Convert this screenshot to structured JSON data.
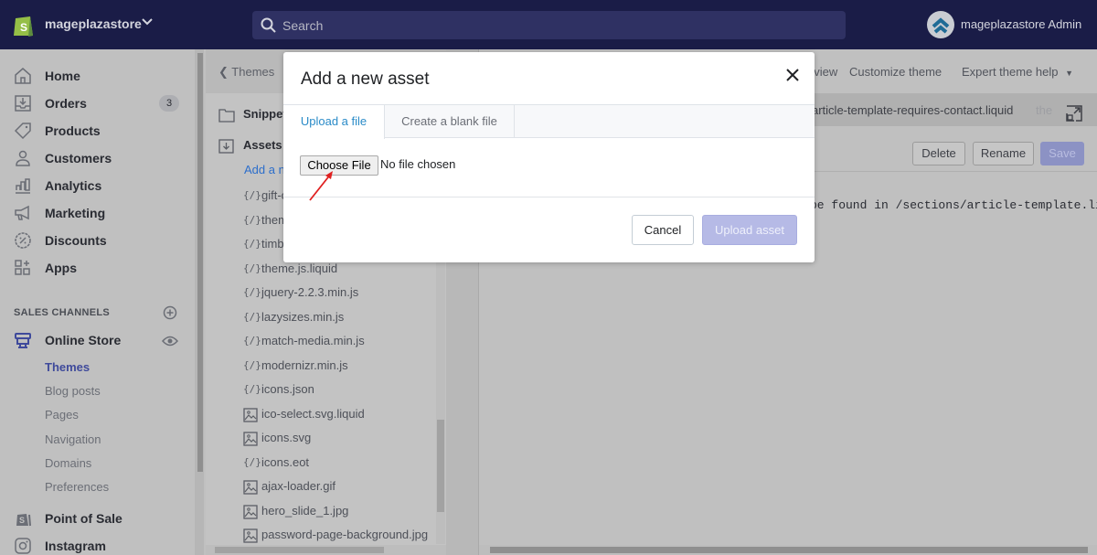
{
  "topbar": {
    "store_name": "mageplazastore",
    "search_placeholder": "Search",
    "admin_name": "mageplazastore Admin",
    "icons": {
      "logo": "shopify-bag-icon",
      "chevron": "chevron-down-icon",
      "search": "search-icon",
      "avatar": "user-avatar-icon"
    }
  },
  "nav": {
    "items": [
      {
        "label": "Home",
        "icon": "home-icon"
      },
      {
        "label": "Orders",
        "icon": "orders-icon",
        "badge": "3"
      },
      {
        "label": "Products",
        "icon": "tag-icon"
      },
      {
        "label": "Customers",
        "icon": "person-icon"
      },
      {
        "label": "Analytics",
        "icon": "bar-chart-icon"
      },
      {
        "label": "Marketing",
        "icon": "megaphone-icon"
      },
      {
        "label": "Discounts",
        "icon": "discount-icon"
      },
      {
        "label": "Apps",
        "icon": "apps-icon"
      }
    ],
    "sales_channels_title": "SALES CHANNELS",
    "online_store": "Online Store",
    "online_store_sub": [
      "Themes",
      "Blog posts",
      "Pages",
      "Navigation",
      "Domains",
      "Preferences"
    ],
    "active_sub": "Themes",
    "point_of_sale": "Point of Sale",
    "instagram": "Instagram"
  },
  "files": {
    "back_label": "Themes",
    "snippets_label": "Snippets",
    "assets_label": "Assets",
    "add_asset_label": "Add a new asset",
    "items": [
      {
        "name": "gift-card.js",
        "type": "code"
      },
      {
        "name": "theme.scss.liquid",
        "type": "code"
      },
      {
        "name": "timber.scss.liquid",
        "type": "code"
      },
      {
        "name": "theme.js.liquid",
        "type": "code"
      },
      {
        "name": "jquery-2.2.3.min.js",
        "type": "code"
      },
      {
        "name": "lazysizes.min.js",
        "type": "code"
      },
      {
        "name": "match-media.min.js",
        "type": "code"
      },
      {
        "name": "modernizr.min.js",
        "type": "code"
      },
      {
        "name": "icons.json",
        "type": "code"
      },
      {
        "name": "ico-select.svg.liquid",
        "type": "image"
      },
      {
        "name": "icons.svg",
        "type": "image"
      },
      {
        "name": "icons.eot",
        "type": "code"
      },
      {
        "name": "ajax-loader.gif",
        "type": "image"
      },
      {
        "name": "hero_slide_1.jpg",
        "type": "image"
      },
      {
        "name": "password-page-background.jpg",
        "type": "image"
      }
    ]
  },
  "editor": {
    "top_actions": {
      "preview": "Preview",
      "customize": "Customize theme",
      "expert_help": "Expert theme help"
    },
    "open_file": "article-template-requires-contact.liquid",
    "faded_tab": "the",
    "buttons": {
      "delete": "Delete",
      "rename": "Rename",
      "save": "Save"
    },
    "code_line": "be found in /sections/article-template.liquid"
  },
  "modal": {
    "title": "Add a new asset",
    "tabs": [
      "Upload a file",
      "Create a blank file"
    ],
    "active_tab": "Upload a file",
    "choose_file_label": "Choose File",
    "no_file_label": "No file chosen",
    "cancel_label": "Cancel",
    "upload_label": "Upload asset"
  },
  "colors": {
    "topbar_bg": "#1a1c47",
    "accent_link": "#2a8bc8",
    "primary_disabled": "#b6bae6",
    "active_nav": "#3f4a9b",
    "annotation_arrow": "#e02020"
  }
}
